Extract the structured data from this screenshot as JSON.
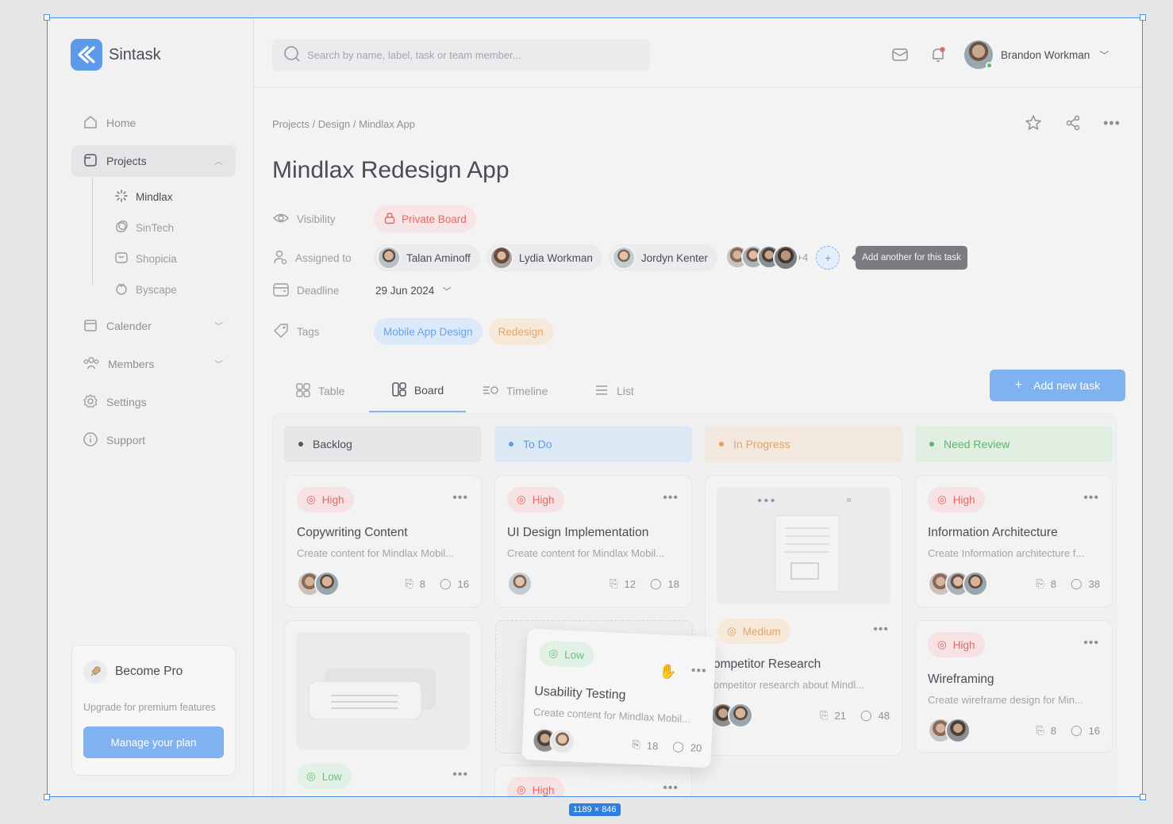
{
  "app": {
    "name": "Sintask"
  },
  "search": {
    "placeholder": "Search by name, label, task or team member..."
  },
  "user": {
    "name": "Brandon Workman"
  },
  "sidebar": {
    "items": [
      {
        "label": "Home"
      },
      {
        "label": "Projects"
      },
      {
        "label": "Calender"
      },
      {
        "label": "Members"
      },
      {
        "label": "Settings"
      },
      {
        "label": "Support"
      }
    ],
    "projects": [
      {
        "label": "Mindlax"
      },
      {
        "label": "SinTech"
      },
      {
        "label": "Shopicia"
      },
      {
        "label": "Byscape"
      }
    ],
    "pro": {
      "title": "Become Pro",
      "subtitle": "Upgrade for premium features",
      "button": "Manage your plan"
    }
  },
  "breadcrumb": "Projects / Design / Mindlax App",
  "page_title": "Mindlax Redesign App",
  "meta": {
    "visibility_label": "Visibility",
    "visibility_value": "Private Board",
    "assigned_label": "Assigned to",
    "assignees": [
      "Talan Aminoff",
      "Lydia Workman",
      "Jordyn Kenter"
    ],
    "more_count": "+4",
    "tooltip": "Add another for this task",
    "deadline_label": "Deadline",
    "deadline_value": "29 Jun 2024",
    "tags_label": "Tags",
    "tags": [
      "Mobile App Design",
      "Redesign"
    ]
  },
  "tabs": [
    {
      "label": "Table"
    },
    {
      "label": "Board"
    },
    {
      "label": "Timeline"
    },
    {
      "label": "List"
    }
  ],
  "add_task": "Add new task",
  "columns": [
    {
      "label": "Backlog",
      "color": "#55585f"
    },
    {
      "label": "To Do",
      "color": "#5b9bea"
    },
    {
      "label": "In Progress",
      "color": "#e0a468"
    },
    {
      "label": "Need Review",
      "color": "#5cb56e"
    }
  ],
  "cards": {
    "c1": {
      "priority": "High",
      "title": "Copywriting Content",
      "desc": "Create content for Mindlax Mobil...",
      "attachments": "8",
      "comments": "16"
    },
    "c2": {
      "priority": "High",
      "title": "UI Design Implementation",
      "desc": "Create content for Mindlax Mobil...",
      "attachments": "12",
      "comments": "18"
    },
    "c3": {
      "priority": "Medium",
      "title": "ompetitor Research",
      "desc": "ompetitor research about Mindl...",
      "attachments": "21",
      "comments": "48"
    },
    "c4": {
      "priority": "High",
      "title": "Information Architecture",
      "desc": "Create Information architecture f...",
      "attachments": "8",
      "comments": "38"
    },
    "c5": {
      "priority": "High",
      "title": "Wireframing",
      "desc": "Create wireframe design for Min...",
      "attachments": "8",
      "comments": "16"
    },
    "c6": {
      "priority": "Low"
    },
    "c7": {
      "priority": "High"
    },
    "drag": {
      "priority": "Low",
      "title": "Usability Testing",
      "desc": "Create content for Mindlax Mobil...",
      "attachments": "18",
      "comments": "20"
    }
  },
  "frame_size": "1189 × 846"
}
